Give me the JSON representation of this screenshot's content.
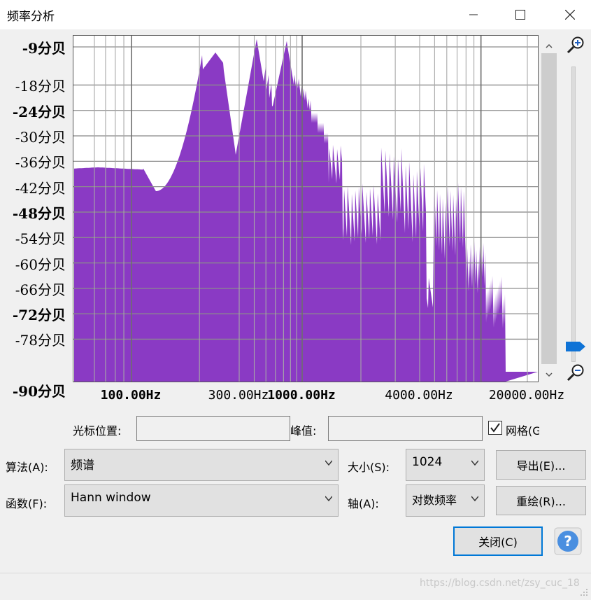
{
  "window": {
    "title": "频率分析",
    "minimize_icon": "minimize-icon",
    "maximize_icon": "maximize-icon",
    "close_icon": "close-icon"
  },
  "spectrum": {
    "color": "#8a3ac4",
    "y_labels": [
      {
        "text": "-9分贝",
        "db": -9,
        "bold": true
      },
      {
        "text": "-18分贝",
        "db": -18,
        "bold": false
      },
      {
        "text": "-24分贝",
        "db": -24,
        "bold": true
      },
      {
        "text": "-30分贝",
        "db": -30,
        "bold": false
      },
      {
        "text": "-36分贝",
        "db": -36,
        "bold": false
      },
      {
        "text": "-42分贝",
        "db": -42,
        "bold": false
      },
      {
        "text": "-48分贝",
        "db": -48,
        "bold": true
      },
      {
        "text": "-54分贝",
        "db": -54,
        "bold": false
      },
      {
        "text": "-60分贝",
        "db": -60,
        "bold": false
      },
      {
        "text": "-66分贝",
        "db": -66,
        "bold": false
      },
      {
        "text": "-72分贝",
        "db": -72,
        "bold": true
      },
      {
        "text": "-78分贝",
        "db": -78,
        "bold": false
      },
      {
        "text": "-90分贝",
        "db": -90,
        "bold": true
      }
    ],
    "x_labels": [
      {
        "text": "100.00Hz",
        "hz": 100,
        "bold": true
      },
      {
        "text": "300.00Hz",
        "hz": 300,
        "bold": false
      },
      {
        "text": "1000.00Hz",
        "hz": 1000,
        "bold": true
      },
      {
        "text": "4000.00Hz",
        "hz": 4000,
        "bold": false
      },
      {
        "text": "20000.00Hz",
        "hz": 20000,
        "bold": false
      }
    ]
  },
  "controls": {
    "cursor_label": "光标位置:",
    "cursor_value": "",
    "peak_label": "峰值:",
    "peak_value": "",
    "grid_label": "网格(G",
    "grid_checked": true,
    "algorithm_label": "算法(A):",
    "algorithm_value": "频谱",
    "size_label": "大小(S):",
    "size_value": "1024",
    "export_label": "导出(E)...",
    "function_label": "函数(F):",
    "function_value": "Hann window",
    "axis_label": "轴(A):",
    "axis_value": "对数频率",
    "replot_label": "重绘(R)...",
    "close_label": "关闭(C)",
    "help_icon": "help-icon",
    "help_glyph": "?"
  },
  "watermark": "https://blog.csdn.net/zsy_cuc_18"
}
